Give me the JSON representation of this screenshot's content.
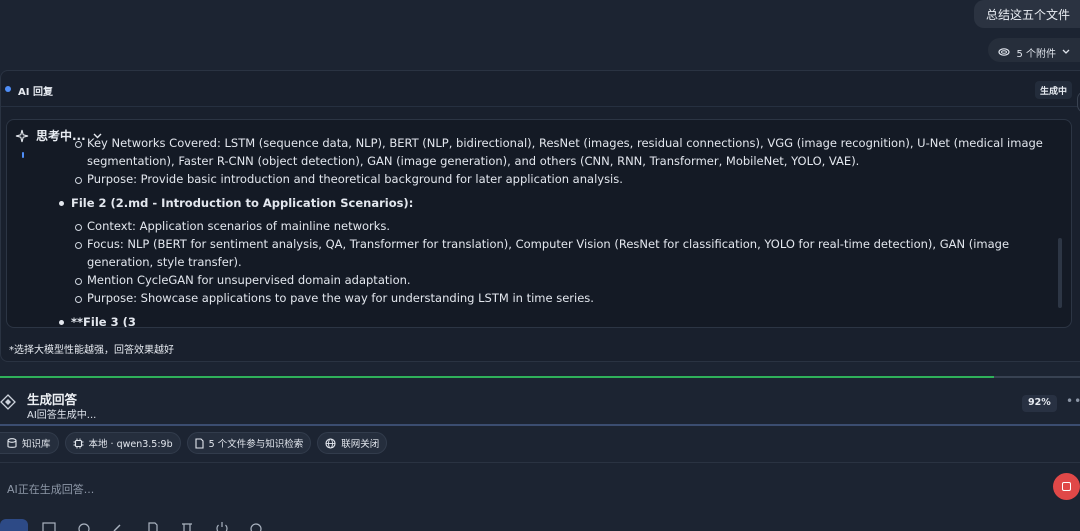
{
  "user_message": {
    "text": "总结这五个文件"
  },
  "attachments": {
    "label": "5 个附件"
  },
  "ai_panel": {
    "title": "AI 回复",
    "status_badge": "生成中",
    "thinking": {
      "title": "思考中...",
      "lines": [
        "Key Networks Covered: LSTM (sequence data, NLP), BERT (NLP, bidirectional), ResNet (images, residual connections), VGG (image recognition), U-Net (medical image segmentation), Faster R-CNN (object detection), GAN (image generation), and others (CNN, RNN, Transformer, MobileNet, YOLO, VAE).",
        "Purpose: Provide basic introduction and theoretical background for later application analysis.",
        "File 2 (2.md - Introduction to Application Scenarios):",
        "Context: Application scenarios of mainline networks.",
        "Focus: NLP (BERT for sentiment analysis, QA, Transformer for translation), Computer Vision (ResNet for classification, YOLO for real-time detection), GAN (image generation, style transfer).",
        "Mention CycleGAN for unsupervised domain adaptation.",
        "Purpose: Showcase applications to pave the way for understanding LSTM in time series.",
        "**File 3 (3"
      ]
    },
    "tip": "*选择大模型性能越强，回答效果越好"
  },
  "progress": {
    "title": "生成回答",
    "subtitle": "AI回答生成中...",
    "percent_label": "92%",
    "percent": 0.92
  },
  "chips": {
    "knowledge_base": "知识库",
    "model": "本地 · qwen3.5:9b",
    "files": "5 个文件参与知识检索",
    "web": "联网关闭"
  },
  "input": {
    "placeholder": "AI正在生成回答..."
  },
  "colors": {
    "accent": "#4f8ef7",
    "progress": "#2fb15a",
    "stop": "#e04848"
  }
}
